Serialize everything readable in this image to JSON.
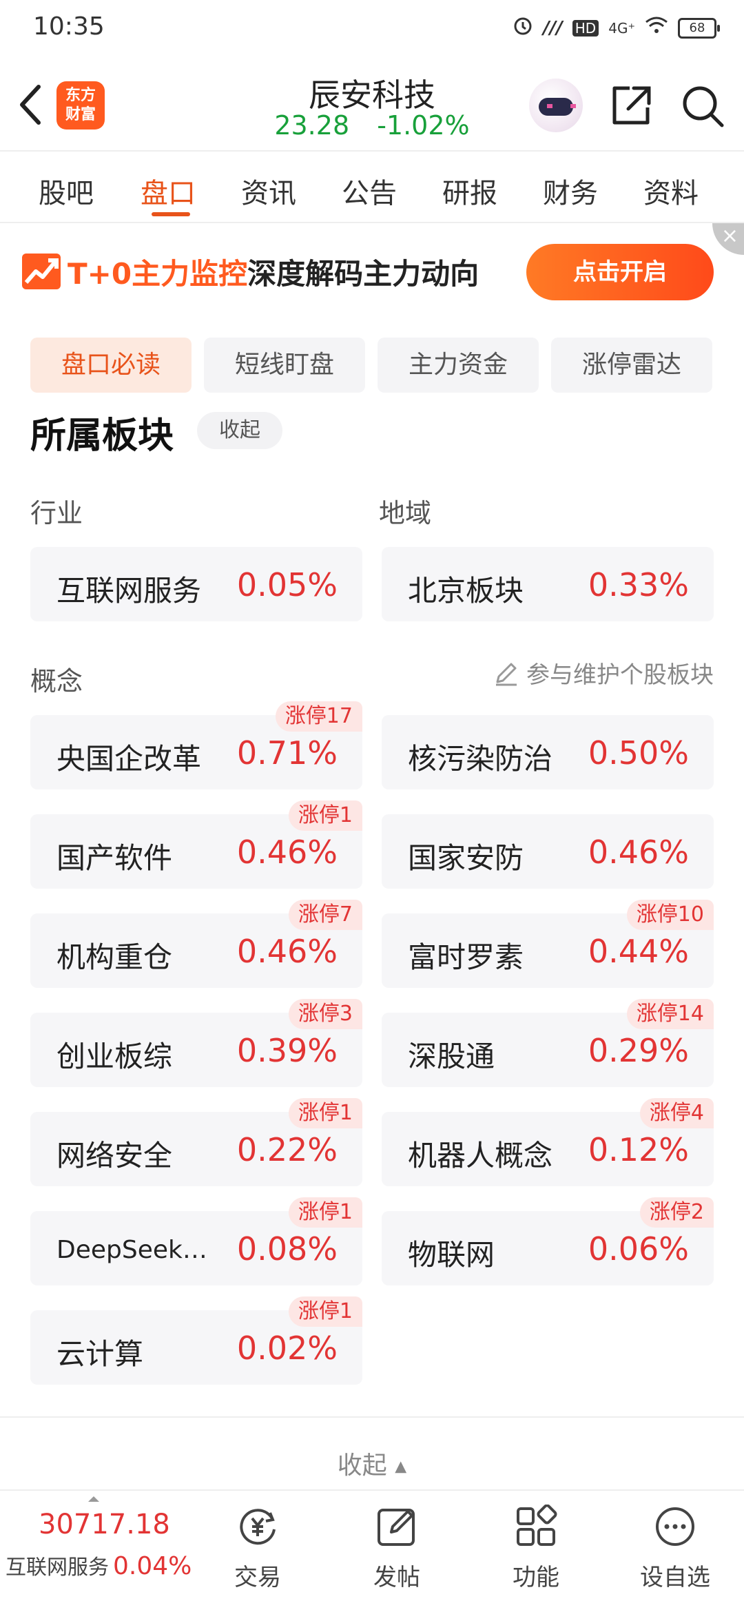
{
  "status_bar": {
    "time": "10:35",
    "network": "4G⁺",
    "hd": "HD",
    "battery": "68"
  },
  "header": {
    "stock_name": "辰安科技",
    "price": "23.28",
    "change_pct": "-1.02%",
    "logo_line1": "东方",
    "logo_line2": "财富"
  },
  "tabs": [
    "股吧",
    "盘口",
    "资讯",
    "公告",
    "研报",
    "财务",
    "资料"
  ],
  "banner": {
    "title_highlight": "T+0主力监控",
    "title_rest": "深度解码主力动向",
    "button": "点击开启",
    "close": "×"
  },
  "subtabs": [
    "盘口必读",
    "短线盯盘",
    "主力资金",
    "涨停雷达"
  ],
  "section": {
    "title": "所属板块",
    "collapse": "收起",
    "industry_label": "行业",
    "region_label": "地域",
    "concept_label": "概念",
    "maintain_link": "参与维护个股板块"
  },
  "industry": {
    "name": "互联网服务",
    "pct": "0.05%"
  },
  "region": {
    "name": "北京板块",
    "pct": "0.33%"
  },
  "concepts": [
    {
      "name": "央国企改革",
      "pct": "0.71%",
      "badge": "涨停17"
    },
    {
      "name": "核污染防治",
      "pct": "0.50%",
      "badge": ""
    },
    {
      "name": "国产软件",
      "pct": "0.46%",
      "badge": "涨停1"
    },
    {
      "name": "国家安防",
      "pct": "0.46%",
      "badge": ""
    },
    {
      "name": "机构重仓",
      "pct": "0.46%",
      "badge": "涨停7"
    },
    {
      "name": "富时罗素",
      "pct": "0.44%",
      "badge": "涨停10"
    },
    {
      "name": "创业板综",
      "pct": "0.39%",
      "badge": "涨停3"
    },
    {
      "name": "深股通",
      "pct": "0.29%",
      "badge": "涨停14"
    },
    {
      "name": "网络安全",
      "pct": "0.22%",
      "badge": "涨停1"
    },
    {
      "name": "机器人概念",
      "pct": "0.12%",
      "badge": "涨停4"
    },
    {
      "name": "DeepSeek…",
      "pct": "0.08%",
      "badge": "涨停1"
    },
    {
      "name": "物联网",
      "pct": "0.06%",
      "badge": "涨停2"
    },
    {
      "name": "云计算",
      "pct": "0.02%",
      "badge": "涨停1"
    }
  ],
  "bottom_collapse": "收起",
  "bottom_bar": {
    "index_value": "30717.18",
    "index_name": "互联网服务",
    "index_pct": "0.04%",
    "items": [
      "交易",
      "发帖",
      "功能",
      "设自选"
    ]
  },
  "colors": {
    "accent": "#e8531a",
    "up": "#e23434",
    "down": "#18a03a"
  }
}
